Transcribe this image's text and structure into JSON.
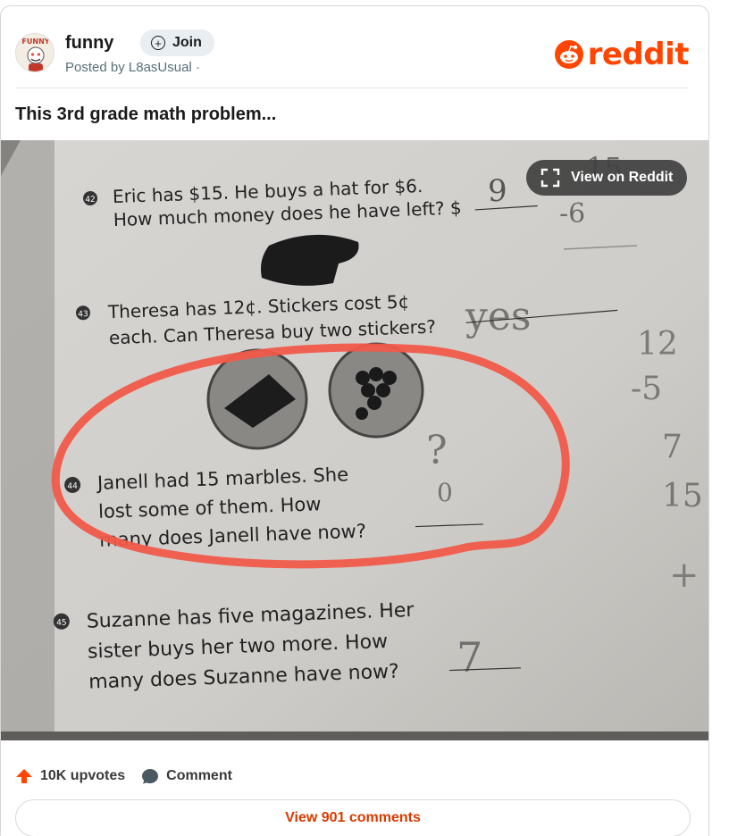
{
  "post": {
    "subreddit": "funny",
    "join_label": "Join",
    "posted_prefix": "Posted by",
    "author": "L8asUsual",
    "posted_suffix": "·",
    "title": "This 3rd grade math problem..."
  },
  "brand": {
    "wordmark": "reddit",
    "color": "#ff4500",
    "icon": "reddit-alien-icon"
  },
  "media": {
    "view_button_label": "View on Reddit",
    "worksheet": {
      "q42": {
        "number": "42",
        "line1": "Eric has $15. He buys a hat for $6.",
        "line2": "How much money does he have left? $"
      },
      "q43": {
        "number": "43",
        "line1": "Theresa has 12¢. Stickers cost 5¢",
        "line2": "each. Can Theresa buy two stickers?"
      },
      "q44": {
        "number": "44",
        "line1": "Janell had 15 marbles. She",
        "line2": "lost some of them. How",
        "line3": "many does Janell have now?"
      },
      "q45": {
        "number": "45",
        "line1": "Suzanne has five magazines. Her",
        "line2": "sister buys her two more. How",
        "line3": "many does Suzanne have now?"
      }
    }
  },
  "footer": {
    "upvotes_label": "10K upvotes",
    "comment_label": "Comment",
    "view_comments_label": "View 901 comments"
  },
  "colors": {
    "upvote": "#ff4500",
    "link": "#d93a00",
    "highlight_circle": "#f05a4a"
  }
}
